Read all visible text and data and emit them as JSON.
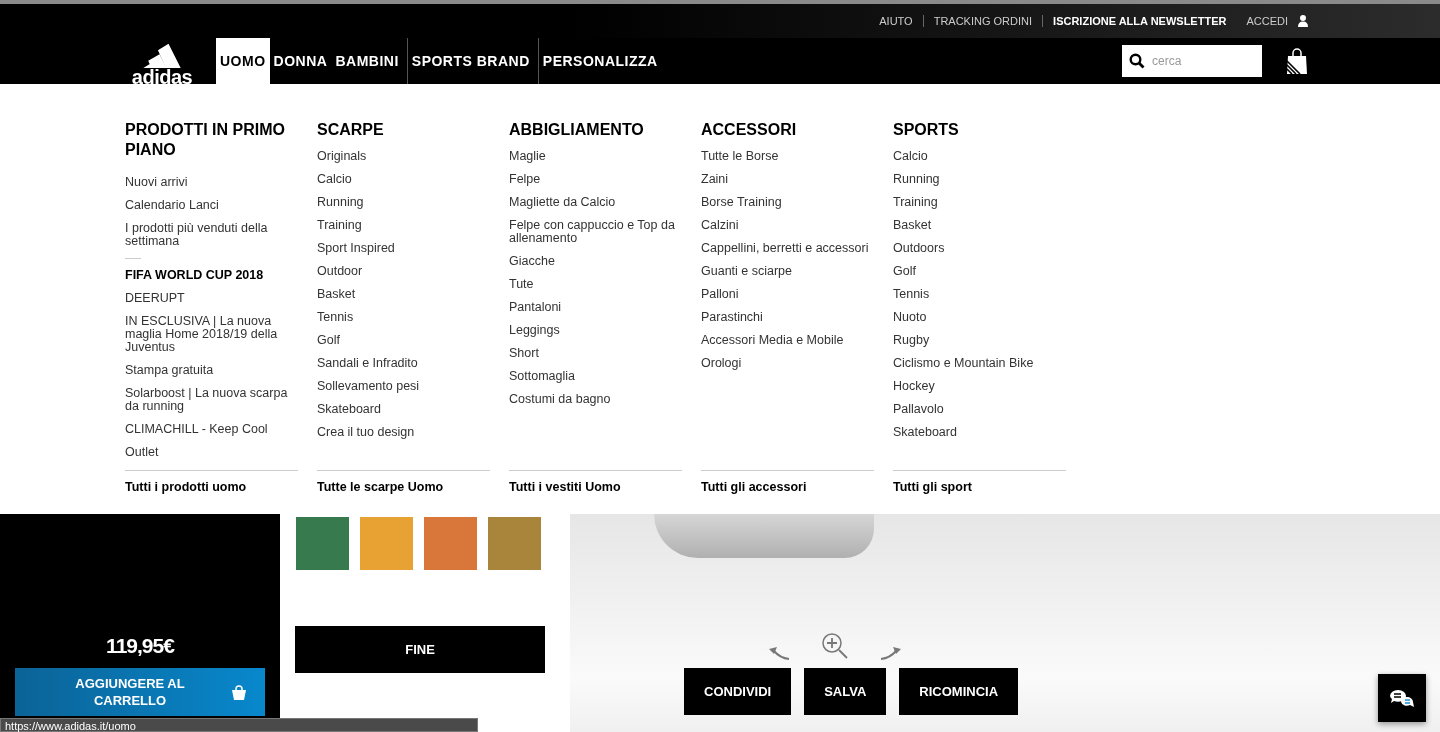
{
  "utility_links": [
    {
      "label": "AIUTO",
      "bold": false,
      "separated": true
    },
    {
      "label": "TRACKING ORDINI",
      "bold": false,
      "separated": true
    },
    {
      "label": "ISCRIZIONE ALLA NEWSLETTER",
      "bold": true,
      "separated": false
    },
    {
      "label": "ACCEDI",
      "bold": false,
      "separated": false
    }
  ],
  "logo": {
    "text": "adidas"
  },
  "nav": [
    {
      "label": "UOMO",
      "selected": true,
      "separated": false
    },
    {
      "label": "DONNA",
      "selected": false,
      "separated": false
    },
    {
      "label": "BAMBINI",
      "selected": false,
      "separated": false
    },
    {
      "label": "SPORTS BRAND",
      "selected": false,
      "separated": true
    },
    {
      "label": "PERSONALIZZA",
      "selected": false,
      "separated": true
    }
  ],
  "search": {
    "placeholder": "cerca"
  },
  "menu_columns": [
    {
      "title": "PRODOTTI IN PRIMO PIANO",
      "items": [
        {
          "kind": "link",
          "label": "Nuovi arrivi"
        },
        {
          "kind": "link",
          "label": "Calendario Lanci"
        },
        {
          "kind": "link",
          "label": "I prodotti più venduti della settimana"
        },
        {
          "kind": "separator"
        },
        {
          "kind": "highlight",
          "label": "FIFA WORLD CUP 2018"
        },
        {
          "kind": "link",
          "label": "DEERUPT"
        },
        {
          "kind": "link",
          "label": "IN ESCLUSIVA | La nuova maglia Home 2018/19 della Juventus"
        },
        {
          "kind": "link",
          "label": "Stampa gratuita"
        },
        {
          "kind": "link",
          "label": "Solarboost | La nuova scarpa da running"
        },
        {
          "kind": "link",
          "label": "CLIMACHILL - Keep Cool"
        },
        {
          "kind": "link",
          "label": "Outlet"
        }
      ],
      "footer": "Tutti i prodotti uomo"
    },
    {
      "title": "SCARPE",
      "items": [
        {
          "kind": "link",
          "label": "Originals"
        },
        {
          "kind": "link",
          "label": "Calcio"
        },
        {
          "kind": "link",
          "label": "Running"
        },
        {
          "kind": "link",
          "label": "Training"
        },
        {
          "kind": "link",
          "label": "Sport Inspired"
        },
        {
          "kind": "link",
          "label": "Outdoor"
        },
        {
          "kind": "link",
          "label": "Basket"
        },
        {
          "kind": "link",
          "label": "Tennis"
        },
        {
          "kind": "link",
          "label": "Golf"
        },
        {
          "kind": "link",
          "label": "Sandali e Infradito"
        },
        {
          "kind": "link",
          "label": "Sollevamento pesi"
        },
        {
          "kind": "link",
          "label": "Skateboard"
        },
        {
          "kind": "link",
          "label": "Crea il tuo design"
        }
      ],
      "footer": "Tutte le scarpe Uomo"
    },
    {
      "title": "ABBIGLIAMENTO",
      "items": [
        {
          "kind": "link",
          "label": "Maglie"
        },
        {
          "kind": "link",
          "label": "Felpe"
        },
        {
          "kind": "link",
          "label": "Magliette da Calcio"
        },
        {
          "kind": "link",
          "label": "Felpe con cappuccio e Top da allenamento"
        },
        {
          "kind": "link",
          "label": "Giacche"
        },
        {
          "kind": "link",
          "label": "Tute"
        },
        {
          "kind": "link",
          "label": "Pantaloni"
        },
        {
          "kind": "link",
          "label": "Leggings"
        },
        {
          "kind": "link",
          "label": "Short"
        },
        {
          "kind": "link",
          "label": "Sottomaglia"
        },
        {
          "kind": "link",
          "label": "Costumi da bagno"
        }
      ],
      "footer": "Tutti i vestiti Uomo"
    },
    {
      "title": "ACCESSORI",
      "items": [
        {
          "kind": "link",
          "label": "Tutte le Borse"
        },
        {
          "kind": "link",
          "label": "Zaini"
        },
        {
          "kind": "link",
          "label": "Borse Training"
        },
        {
          "kind": "link",
          "label": "Calzini"
        },
        {
          "kind": "link",
          "label": "Cappellini, berretti e accessori"
        },
        {
          "kind": "link",
          "label": "Guanti e sciarpe"
        },
        {
          "kind": "link",
          "label": "Palloni"
        },
        {
          "kind": "link",
          "label": "Parastinchi"
        },
        {
          "kind": "link",
          "label": "Accessori Media e Mobile"
        },
        {
          "kind": "link",
          "label": "Orologi"
        }
      ],
      "footer": "Tutti gli accessori"
    },
    {
      "title": "SPORTS",
      "items": [
        {
          "kind": "link",
          "label": "Calcio"
        },
        {
          "kind": "link",
          "label": "Running"
        },
        {
          "kind": "link",
          "label": "Training"
        },
        {
          "kind": "link",
          "label": "Basket"
        },
        {
          "kind": "link",
          "label": "Outdoors"
        },
        {
          "kind": "link",
          "label": "Golf"
        },
        {
          "kind": "link",
          "label": "Tennis"
        },
        {
          "kind": "link",
          "label": "Nuoto"
        },
        {
          "kind": "link",
          "label": "Rugby"
        },
        {
          "kind": "link",
          "label": "Ciclismo e Mountain Bike"
        },
        {
          "kind": "link",
          "label": "Hockey"
        },
        {
          "kind": "link",
          "label": "Pallavolo"
        },
        {
          "kind": "link",
          "label": "Skateboard"
        }
      ],
      "footer": "Tutti gli sport"
    }
  ],
  "product": {
    "price": "119,95€",
    "cart_button": "AGGIUNGERE AL CARRELLO"
  },
  "swatches": [
    {
      "color": "#377a4e",
      "selected": false
    },
    {
      "color": "#e8a133",
      "selected": false
    },
    {
      "color": "#d9773a",
      "selected": false
    },
    {
      "color": "#a8853a",
      "selected": false
    }
  ],
  "finish_button": "FINE",
  "actions": [
    "CONDIVIDI",
    "SALVA",
    "RICOMINCIA"
  ],
  "status_url": "https://www.adidas.it/uomo"
}
